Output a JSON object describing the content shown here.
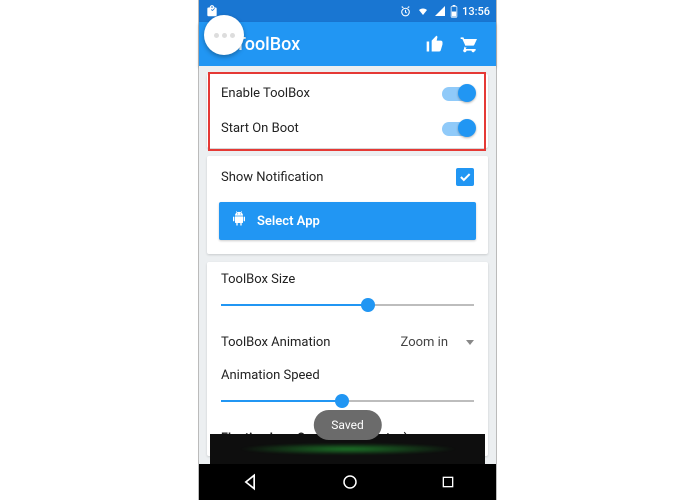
{
  "statusbar": {
    "time": "13:56",
    "icons": {
      "shop": "shop-bag-icon",
      "alarm": "alarm-icon",
      "wifi": "wifi-icon",
      "signal": "signal-icon",
      "battery": "battery-icon"
    }
  },
  "appbar": {
    "title": "ToolBox",
    "actions": {
      "thumb": "Like",
      "cart": "Cart"
    }
  },
  "card1": {
    "enable_label": "Enable ToolBox",
    "boot_label": "Start On Boot",
    "enable_on": true,
    "boot_on": true
  },
  "card2": {
    "notif_label": "Show Notification",
    "notif_checked": true,
    "select_app_label": "Select App"
  },
  "card3": {
    "size_label": "ToolBox Size",
    "size_pct": 58,
    "anim_label": "ToolBox Animation",
    "anim_value": "Zoom in",
    "speed_label": "Animation Speed",
    "speed_pct": 48,
    "opacity_label": "Floating Icon Opacity(Idle Status)"
  },
  "toast": {
    "text": "Saved"
  },
  "colors": {
    "primary": "#2196F3",
    "primary_dark": "#1976D2",
    "accent_red": "#E53935"
  },
  "nav": {
    "back": "back",
    "home": "home",
    "recent": "recent"
  }
}
